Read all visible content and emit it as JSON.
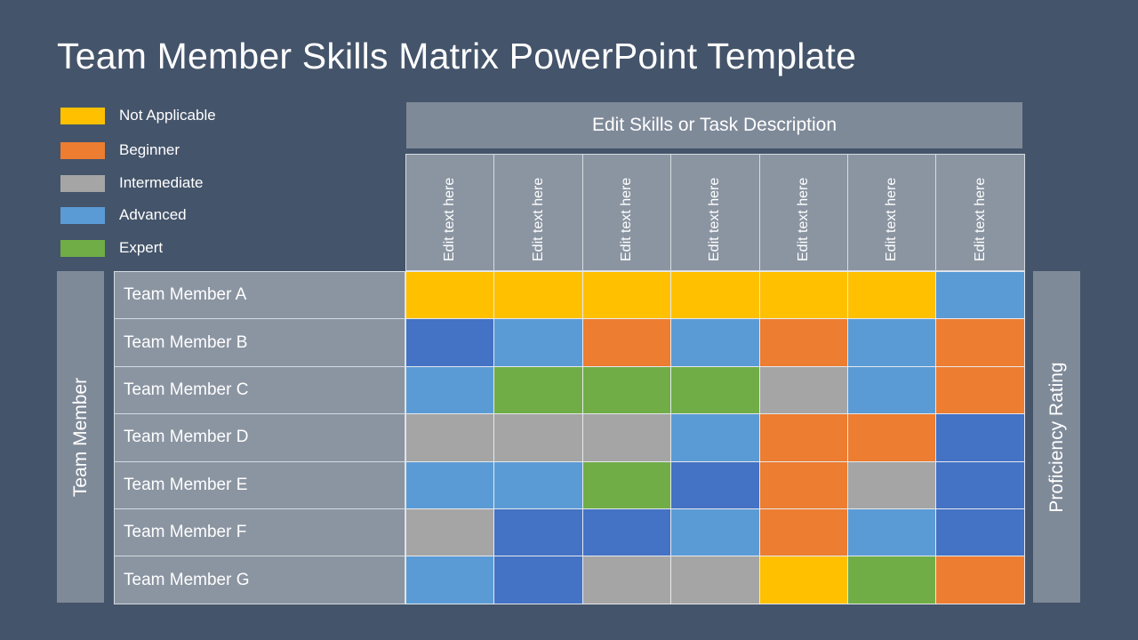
{
  "title": "Team Member Skills Matrix PowerPoint Template",
  "legend": [
    {
      "label": "Not Applicable",
      "color": "#FFC000"
    },
    {
      "label": "Beginner",
      "color": "#ED7D31"
    },
    {
      "label": "Intermediate",
      "color": "#A5A5A5"
    },
    {
      "label": "Advanced",
      "color": "#5B9BD5"
    },
    {
      "label": "Expert",
      "color": "#70AD47"
    }
  ],
  "skills_header": "Edit Skills or Task Description",
  "left_label": "Team Member",
  "right_label": "Proficiency Rating",
  "chart_data": {
    "type": "heatmap",
    "title": "Team Member Skills Matrix PowerPoint Template",
    "xlabel": "Edit Skills or Task Description",
    "ylabel": "Team Member",
    "zlabel": "Proficiency Rating",
    "columns": [
      "Edit text here",
      "Edit text here",
      "Edit text here",
      "Edit text here",
      "Edit text here",
      "Edit text here",
      "Edit text here"
    ],
    "rows": [
      "Team Member A",
      "Team Member B",
      "Team Member C",
      "Team Member D",
      "Team Member E",
      "Team Member F",
      "Team Member G"
    ],
    "level_colors": {
      "Not Applicable": "#FFC000",
      "Beginner": "#ED7D31",
      "Intermediate": "#A5A5A5",
      "Advanced": "#5B9BD5",
      "Expert": "#70AD47",
      "Dark Blue (unlabeled)": "#4472C4"
    },
    "values": [
      [
        "Not Applicable",
        "Not Applicable",
        "Not Applicable",
        "Not Applicable",
        "Not Applicable",
        "Not Applicable",
        "Advanced"
      ],
      [
        "Dark Blue (unlabeled)",
        "Advanced",
        "Beginner",
        "Advanced",
        "Beginner",
        "Advanced",
        "Beginner"
      ],
      [
        "Advanced",
        "Expert",
        "Expert",
        "Expert",
        "Intermediate",
        "Advanced",
        "Beginner"
      ],
      [
        "Intermediate",
        "Intermediate",
        "Intermediate",
        "Advanced",
        "Beginner",
        "Beginner",
        "Dark Blue (unlabeled)"
      ],
      [
        "Advanced",
        "Advanced",
        "Expert",
        "Dark Blue (unlabeled)",
        "Beginner",
        "Intermediate",
        "Dark Blue (unlabeled)"
      ],
      [
        "Intermediate",
        "Dark Blue (unlabeled)",
        "Dark Blue (unlabeled)",
        "Advanced",
        "Beginner",
        "Advanced",
        "Dark Blue (unlabeled)"
      ],
      [
        "Advanced",
        "Dark Blue (unlabeled)",
        "Intermediate",
        "Intermediate",
        "Not Applicable",
        "Expert",
        "Beginner"
      ]
    ]
  }
}
